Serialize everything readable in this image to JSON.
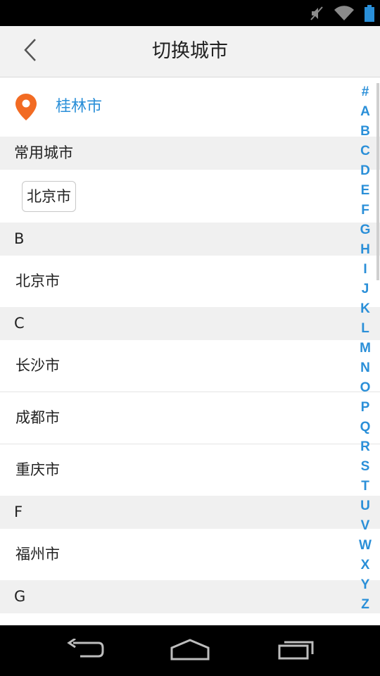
{
  "header": {
    "title": "切换城市",
    "back_icon": "chevron-left-icon"
  },
  "location": {
    "city": "桂林市",
    "icon": "location-pin-icon",
    "pin_color": "#f26b23"
  },
  "hot": {
    "header": "常用城市",
    "cities": [
      "北京市"
    ]
  },
  "sections": [
    {
      "letter": "B",
      "cities": [
        "北京市"
      ]
    },
    {
      "letter": "C",
      "cities": [
        "长沙市",
        "成都市",
        "重庆市"
      ]
    },
    {
      "letter": "F",
      "cities": [
        "福州市"
      ]
    },
    {
      "letter": "G",
      "cities": []
    }
  ],
  "index_letters": [
    "#",
    "A",
    "B",
    "C",
    "D",
    "E",
    "F",
    "G",
    "H",
    "I",
    "J",
    "K",
    "L",
    "M",
    "N",
    "O",
    "P",
    "Q",
    "R",
    "S",
    "T",
    "U",
    "V",
    "W",
    "X",
    "Y",
    "Z"
  ],
  "colors": {
    "accent": "#2a8fd8",
    "section_bg": "#f0f0f0",
    "title_bar_bg": "#f2f2f2"
  },
  "nav": {
    "icons": [
      "back-icon",
      "home-icon",
      "recent-apps-icon"
    ]
  }
}
